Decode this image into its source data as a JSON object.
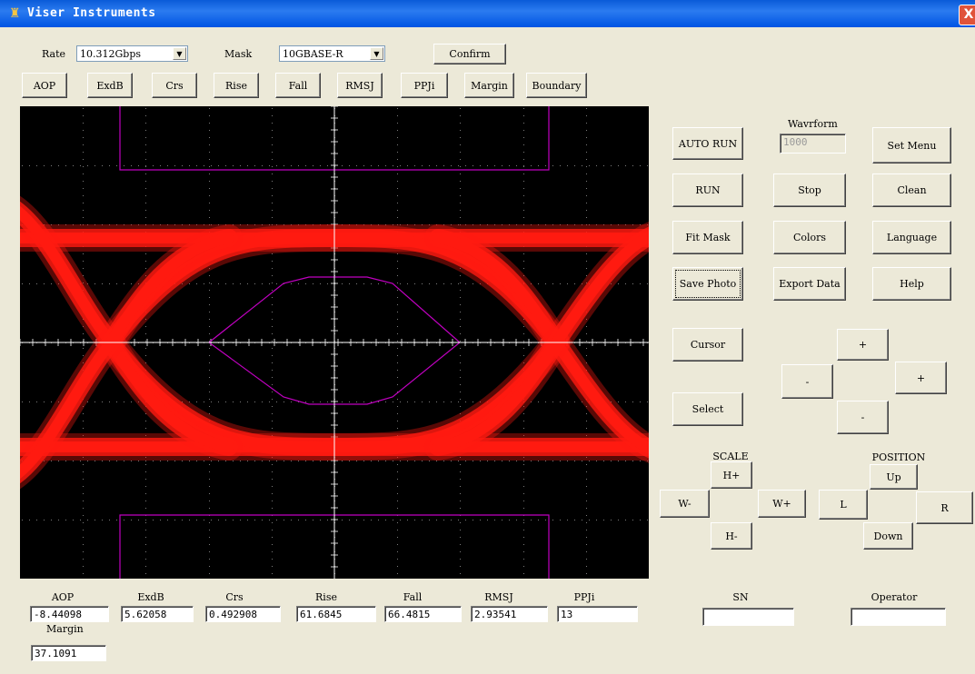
{
  "window": {
    "title": "Viser Instruments",
    "close_label": "X"
  },
  "top": {
    "rate_label": "Rate",
    "rate_value": "10.312Gbps",
    "mask_label": "Mask",
    "mask_value": "10GBASE-R",
    "confirm": "Confirm"
  },
  "toolbar": [
    "AOP",
    "ExdB",
    "Crs",
    "Rise",
    "Fall",
    "RMSJ",
    "PPJi",
    "Margin",
    "Boundary"
  ],
  "scope": {
    "background": "#000000",
    "eye_color": "#ff1a10",
    "mask_color": "#c000c0",
    "grid_color": "#b0b0b0"
  },
  "right_panel": {
    "waveform_label": "Wavrform",
    "waveform_placeholder": "1000",
    "auto_run": "AUTO RUN",
    "set_menu": "Set Menu",
    "run": "RUN",
    "stop": "Stop",
    "clean": "Clean",
    "fit_mask": "Fit Mask",
    "colors": "Colors",
    "language": "Language",
    "save_photo": "Save Photo",
    "export_data": "Export Data",
    "help": "Help",
    "cursor": "Cursor",
    "select": "Select",
    "cursor_plus_top": "+",
    "cursor_minus_left": "-",
    "cursor_plus_right": "+",
    "cursor_minus_bottom": "-",
    "scale_label": "SCALE",
    "h_plus": "H+",
    "w_minus": "W-",
    "w_plus": "W+",
    "h_minus": "H-",
    "position_label": "POSITION",
    "up": "Up",
    "left": "L",
    "right": "R",
    "down": "Down"
  },
  "measurements": [
    {
      "label": "AOP",
      "value": "-8.44098"
    },
    {
      "label": "ExdB",
      "value": "5.62058"
    },
    {
      "label": "Crs",
      "value": "0.492908"
    },
    {
      "label": "Rise",
      "value": "61.6845"
    },
    {
      "label": "Fall",
      "value": "66.4815"
    },
    {
      "label": "RMSJ",
      "value": "2.93541"
    },
    {
      "label": "PPJi",
      "value": "13"
    },
    {
      "label": "Margin",
      "value": "37.1091"
    }
  ],
  "info": {
    "sn_label": "SN",
    "sn_value": "",
    "operator_label": "Operator",
    "operator_value": ""
  }
}
